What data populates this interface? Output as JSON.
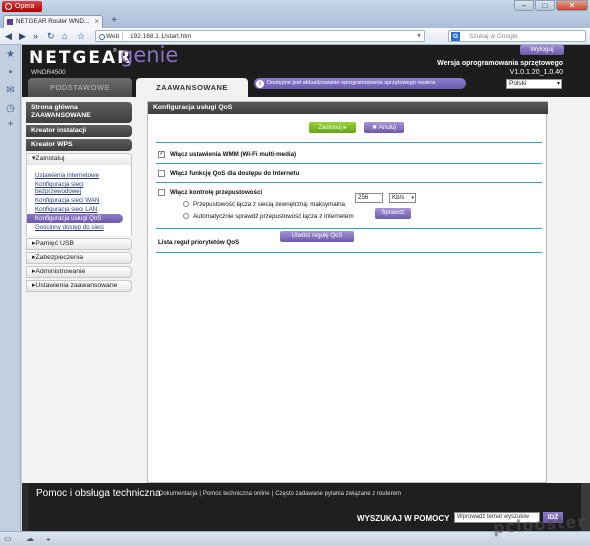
{
  "browser": {
    "menu_label": "Opera",
    "tab_title": "NETGEAR Router WND...",
    "web_badge": "Web",
    "url": "192.168.1.1/start.htm",
    "search_placeholder": "Szukaj w Google"
  },
  "router": {
    "brand": "NETGEAR",
    "product": "genie",
    "model": "WNDR4500",
    "logout_label": "Wyloguj",
    "firmware_label": "Wersja oprogramowania sprzętowego",
    "firmware_version": "V1.0.1.20_1.0.40",
    "language": "Polski",
    "tabs": {
      "basic": "PODSTAWOWE",
      "advanced": "ZAAWANSOWANE"
    },
    "update_notice": "Dostępne jest aktualizowanie oprogramowania sprzętowego routera"
  },
  "nav": {
    "home": "Strona główna ZAAWANSOWANE",
    "setup_wizard": "Kreator instalacji",
    "wps_wizard": "Kreator WPS",
    "setup_section": "▾Zainstaluj",
    "setup_items": [
      "Ustawienia internetowe",
      "Konfiguracja sieci bezprzewodowej",
      "Konfiguracja sieci WAN",
      "Konfiguracja sieci LAN",
      "Konfiguracja usługi QoS",
      "Gościnny dostęp do sieci"
    ],
    "usb_storage": "▸Pamięć USB",
    "security": "▸Zabezpieczenia",
    "administration": "▸Administrowanie",
    "advanced_setup": "▸Ustawienia zaawansowane"
  },
  "qos": {
    "title": "Konfiguracja usługi QoS",
    "apply_label": "Zastosuj ▸",
    "cancel_label": "✖ Anuluj",
    "wmm_label": "Włącz ustawienia WMM (Wi-Fi multi-media)",
    "wmm_checked": true,
    "internet_qos_label": "Włącz funkcję QoS dla dostępu do Internetu",
    "internet_qos_checked": false,
    "bandwidth_label": "Włącz kontrolę przepustowości",
    "bandwidth_checked": false,
    "uplink_manual_label": "Przepustowość łącza z siecią zewnętrzną: maksymalna",
    "uplink_value": "256",
    "uplink_unit": "Kb/s",
    "uplink_auto_label": "Automatycznie sprawdź przepustowość łącza z Internetem",
    "check_button": "Sprawdź",
    "priority_rules_label": "Lista reguł priorytetów QoS",
    "create_rule_button": "Utwórz regułę QoS"
  },
  "help": {
    "title": "Pomoc i obsługa techniczna",
    "links": [
      "Dokumentacja",
      "Pomoc techniczna online",
      "Często zadawane pytania związane z routerem"
    ],
    "search_label": "WYSZUKAJ W POMOCY",
    "search_placeholder": "Wprowadź temat wyszukiw",
    "go_label": "IDŹ"
  },
  "watermark": "pclooster",
  "colors": {
    "accent_purple": "#6c5aa8",
    "apply_green": "#66a318",
    "divider_blue": "#2aa5c9",
    "dark_bar": "#3d3d3d"
  }
}
